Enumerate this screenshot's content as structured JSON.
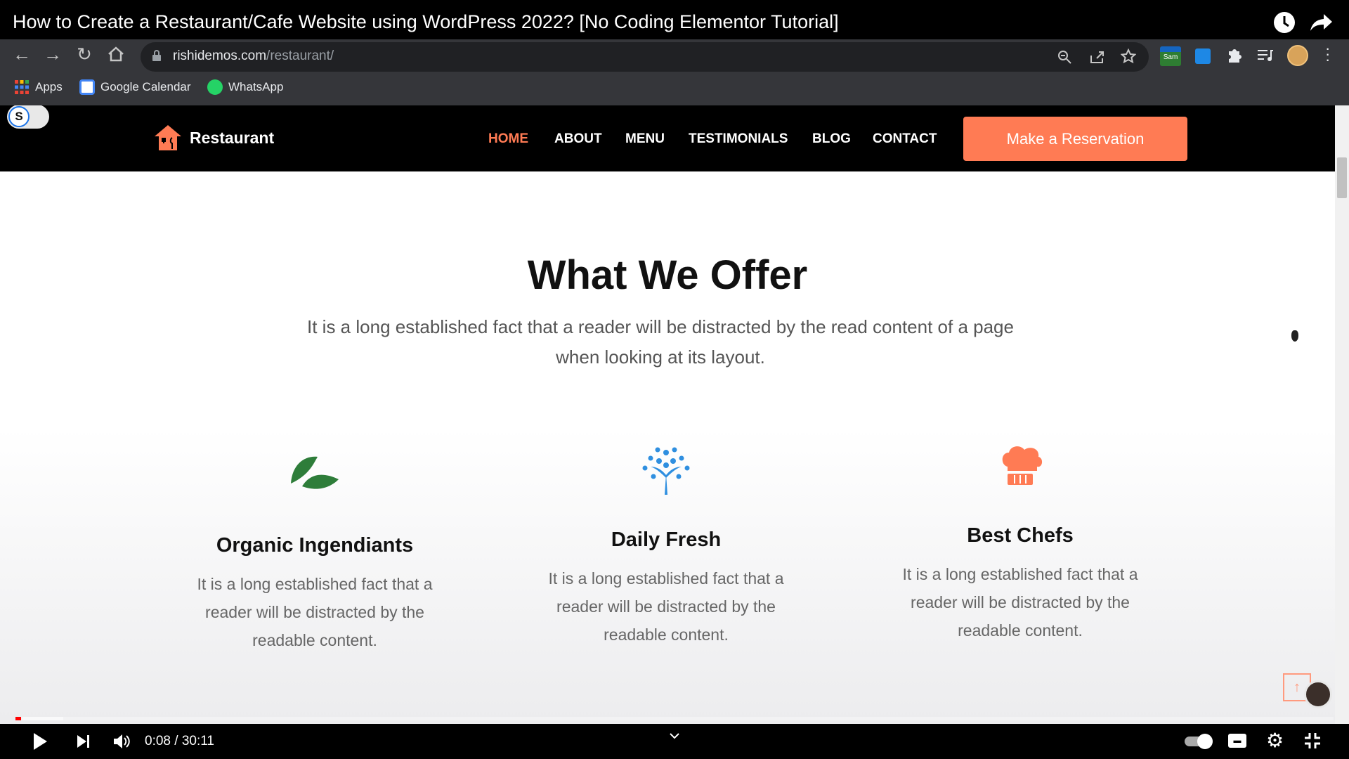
{
  "video": {
    "title": "How to Create a Restaurant/Cafe Website using WordPress 2022? [No Coding Elementor Tutorial]",
    "time": "0:08 / 30:11",
    "progress_fraction": 0.0044
  },
  "browser": {
    "url_host": "rishidemos.com",
    "url_path": "/restaurant/",
    "bookmarks": [
      {
        "label": "Apps",
        "icon": "apps-grid-icon"
      },
      {
        "label": "Google Calendar",
        "icon": "calendar-icon"
      },
      {
        "label": "WhatsApp",
        "icon": "whatsapp-icon"
      }
    ],
    "extension_badge": "Sam"
  },
  "site": {
    "logo_text": "Restaurant",
    "nav": [
      "HOME",
      "ABOUT",
      "MENU",
      "TESTIMONIALS",
      "BLOG",
      "CONTACT"
    ],
    "active_nav": "HOME",
    "cta": "Make a Reservation",
    "toggle_letter": "S",
    "accent_color": "#ff7b54"
  },
  "offer": {
    "title": "What We Offer",
    "subtitle": "It is a long established fact that a reader will be distracted by the read content of a page when looking at its layout.",
    "cards": [
      {
        "icon": "leaf-icon",
        "title": "Organic Ingendiants",
        "text": "It is a long established fact that a reader will be distracted by the readable content."
      },
      {
        "icon": "tree-icon",
        "title": "Daily Fresh",
        "text": "It is a long established fact that a reader will be distracted by the readable content."
      },
      {
        "icon": "chef-hat-icon",
        "title": "Best Chefs",
        "text": "It is a long established fact that a reader will be distracted by the readable content."
      }
    ]
  }
}
